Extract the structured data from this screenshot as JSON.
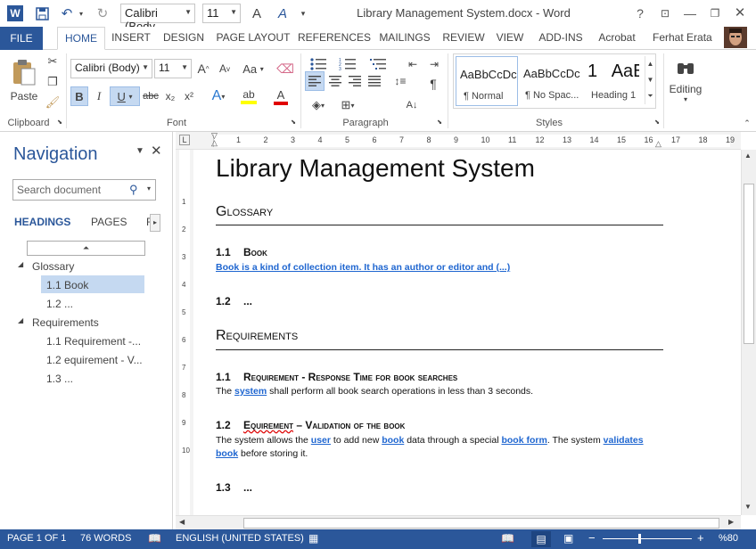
{
  "app": {
    "title": "Library Management System.docx - Word",
    "app_icon": "word-icon"
  },
  "quick_access": {
    "font_name": "Calibri (Body",
    "font_size": "11"
  },
  "window": {
    "help": "?",
    "user": "Ferhat Erata"
  },
  "tabs": [
    "FILE",
    "HOME",
    "INSERT",
    "DESIGN",
    "PAGE LAYOUT",
    "REFERENCES",
    "MAILINGS",
    "REVIEW",
    "VIEW",
    "ADD-INS",
    "Acrobat"
  ],
  "ribbon": {
    "clipboard": {
      "label": "Clipboard",
      "paste": "Paste"
    },
    "font": {
      "label": "Font",
      "name": "Calibri (Body)",
      "size": "11",
      "grow": "A",
      "shrink": "A",
      "case": "Aa",
      "bold": "B",
      "italic": "I",
      "underline": "U",
      "strike": "abc",
      "sub": "x₂",
      "sup": "x²"
    },
    "paragraph": {
      "label": "Paragraph"
    },
    "styles": {
      "label": "Styles",
      "items": [
        {
          "preview": "AaBbCcDc",
          "name": "¶ Normal"
        },
        {
          "preview": "AaBbCcDc",
          "name": "¶ No Spac..."
        },
        {
          "preview": "1   AaE",
          "name": "Heading 1"
        }
      ]
    },
    "editing": {
      "label": "Editing"
    }
  },
  "nav": {
    "title": "Navigation",
    "search_placeholder": "Search document",
    "tabs": [
      "HEADINGS",
      "PAGES",
      "R"
    ],
    "tree": [
      {
        "label": "Glossary",
        "level": 1
      },
      {
        "label": "1.1 Book",
        "level": 2,
        "selected": true
      },
      {
        "label": "1.2 ...",
        "level": 2
      },
      {
        "label": "Requirements",
        "level": 1
      },
      {
        "label": "1.1 Requirement -...",
        "level": 2
      },
      {
        "label": "1.2 equirement - V...",
        "level": 2
      },
      {
        "label": "1.3 ...",
        "level": 2
      }
    ]
  },
  "ruler": {
    "numbers": [
      "1",
      "2",
      "3",
      "4",
      "5",
      "6",
      "7",
      "8",
      "9",
      "10",
      "11",
      "12",
      "13",
      "14",
      "15",
      "16",
      "17",
      "18",
      "19"
    ]
  },
  "document": {
    "title": "Library Management System",
    "glossary": {
      "heading": "Glossary",
      "s11_num": "1.1",
      "s11_title": "Book",
      "s11_text": "Book is a kind of collection item. It has an author or editor and (...)",
      "s12_num": "1.2",
      "s12_title": "..."
    },
    "requirements": {
      "heading": "Requirements",
      "s11_num": "1.1",
      "s11_title": "Requirement - Response Time for book searches",
      "s11_p1": "The ",
      "s11_link": "system",
      "s11_p2": " shall perform all book search operations in less than 3 seconds.",
      "s12_num": "1.2",
      "s12_title_a": "Equirement",
      "s12_title_b": " – Validation of the book",
      "s12_p1": "The system allows the ",
      "s12_l1": "user",
      "s12_p2": " to add new ",
      "s12_l2": "book",
      "s12_p3": " data through a special ",
      "s12_l3": "book form",
      "s12_p4": ". The system ",
      "s12_l4": "validates",
      "s12_l5": "book",
      "s12_p5": " before storing it.",
      "s13_num": "1.3",
      "s13_title": "..."
    }
  },
  "status": {
    "page": "PAGE 1 OF 1",
    "words": "76 WORDS",
    "language": "ENGLISH (UNITED STATES)",
    "zoom": "%80"
  },
  "colors": {
    "accent": "#2b579a",
    "link": "#1f66d0",
    "nav_selected": "#c5d9f1"
  }
}
